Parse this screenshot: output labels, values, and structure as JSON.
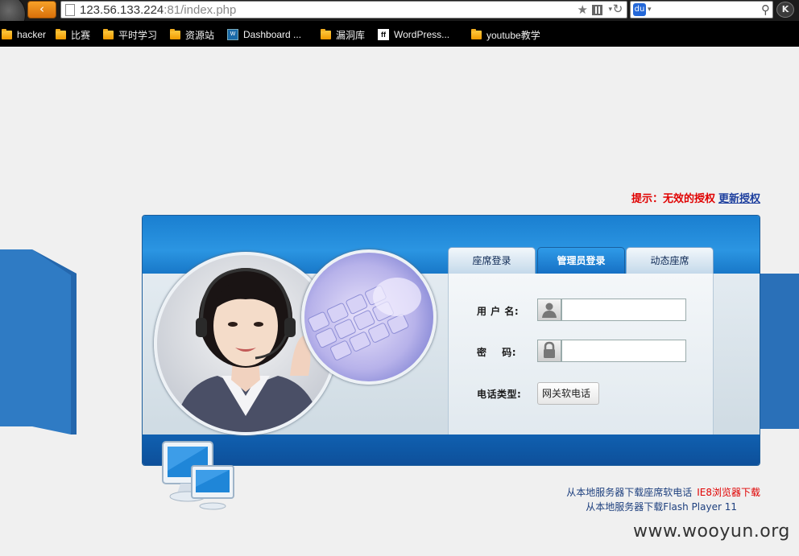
{
  "browser": {
    "url_host": "123.56.133.224",
    "url_rest": ":81/index.php",
    "back_glyph": "‹",
    "star_glyph": "★",
    "reload_glyph": "↻",
    "search_glyph": "⚲",
    "engine_glyph": "🐾",
    "dropdown_glyph": "▾",
    "ext_glyph": "K"
  },
  "bookmarks": [
    {
      "label": "hacker",
      "icon": "folder-icon"
    },
    {
      "label": "比赛",
      "icon": "folder-icon"
    },
    {
      "label": "平时学习",
      "icon": "folder-icon"
    },
    {
      "label": "资源站",
      "icon": "folder-icon"
    },
    {
      "label": "Dashboard ...",
      "icon": "wordpress-dashboard-icon",
      "icon_text": "W"
    },
    {
      "label": "漏洞库",
      "icon": "folder-icon"
    },
    {
      "label": "WordPress...",
      "icon": "ff-icon",
      "icon_text": "ff"
    },
    {
      "label": "youtube教学",
      "icon": "folder-icon"
    }
  ],
  "hint": {
    "label": "提示：无效的授权",
    "link": "更新授权"
  },
  "tabs": [
    {
      "label": "座席登录",
      "active": false
    },
    {
      "label": "管理员登录",
      "active": true
    },
    {
      "label": "动态座席",
      "active": false
    }
  ],
  "form": {
    "username_label": "用 户 名:",
    "password_label": "密    码:",
    "phone_type_label": "电话类型:",
    "phone_type_value": "网关软电话",
    "username_value": "",
    "password_value": ""
  },
  "downloads": {
    "seat_phone": "从本地服务器下载座席软电话",
    "ie8": "IE8浏览器下载",
    "flash": "从本地服务器下载Flash Player 11"
  },
  "watermark": "www.wooyun.org",
  "colors": {
    "accent_blue": "#1a7fd0",
    "link_red": "#e00000",
    "link_blue": "#1d3f9e"
  }
}
